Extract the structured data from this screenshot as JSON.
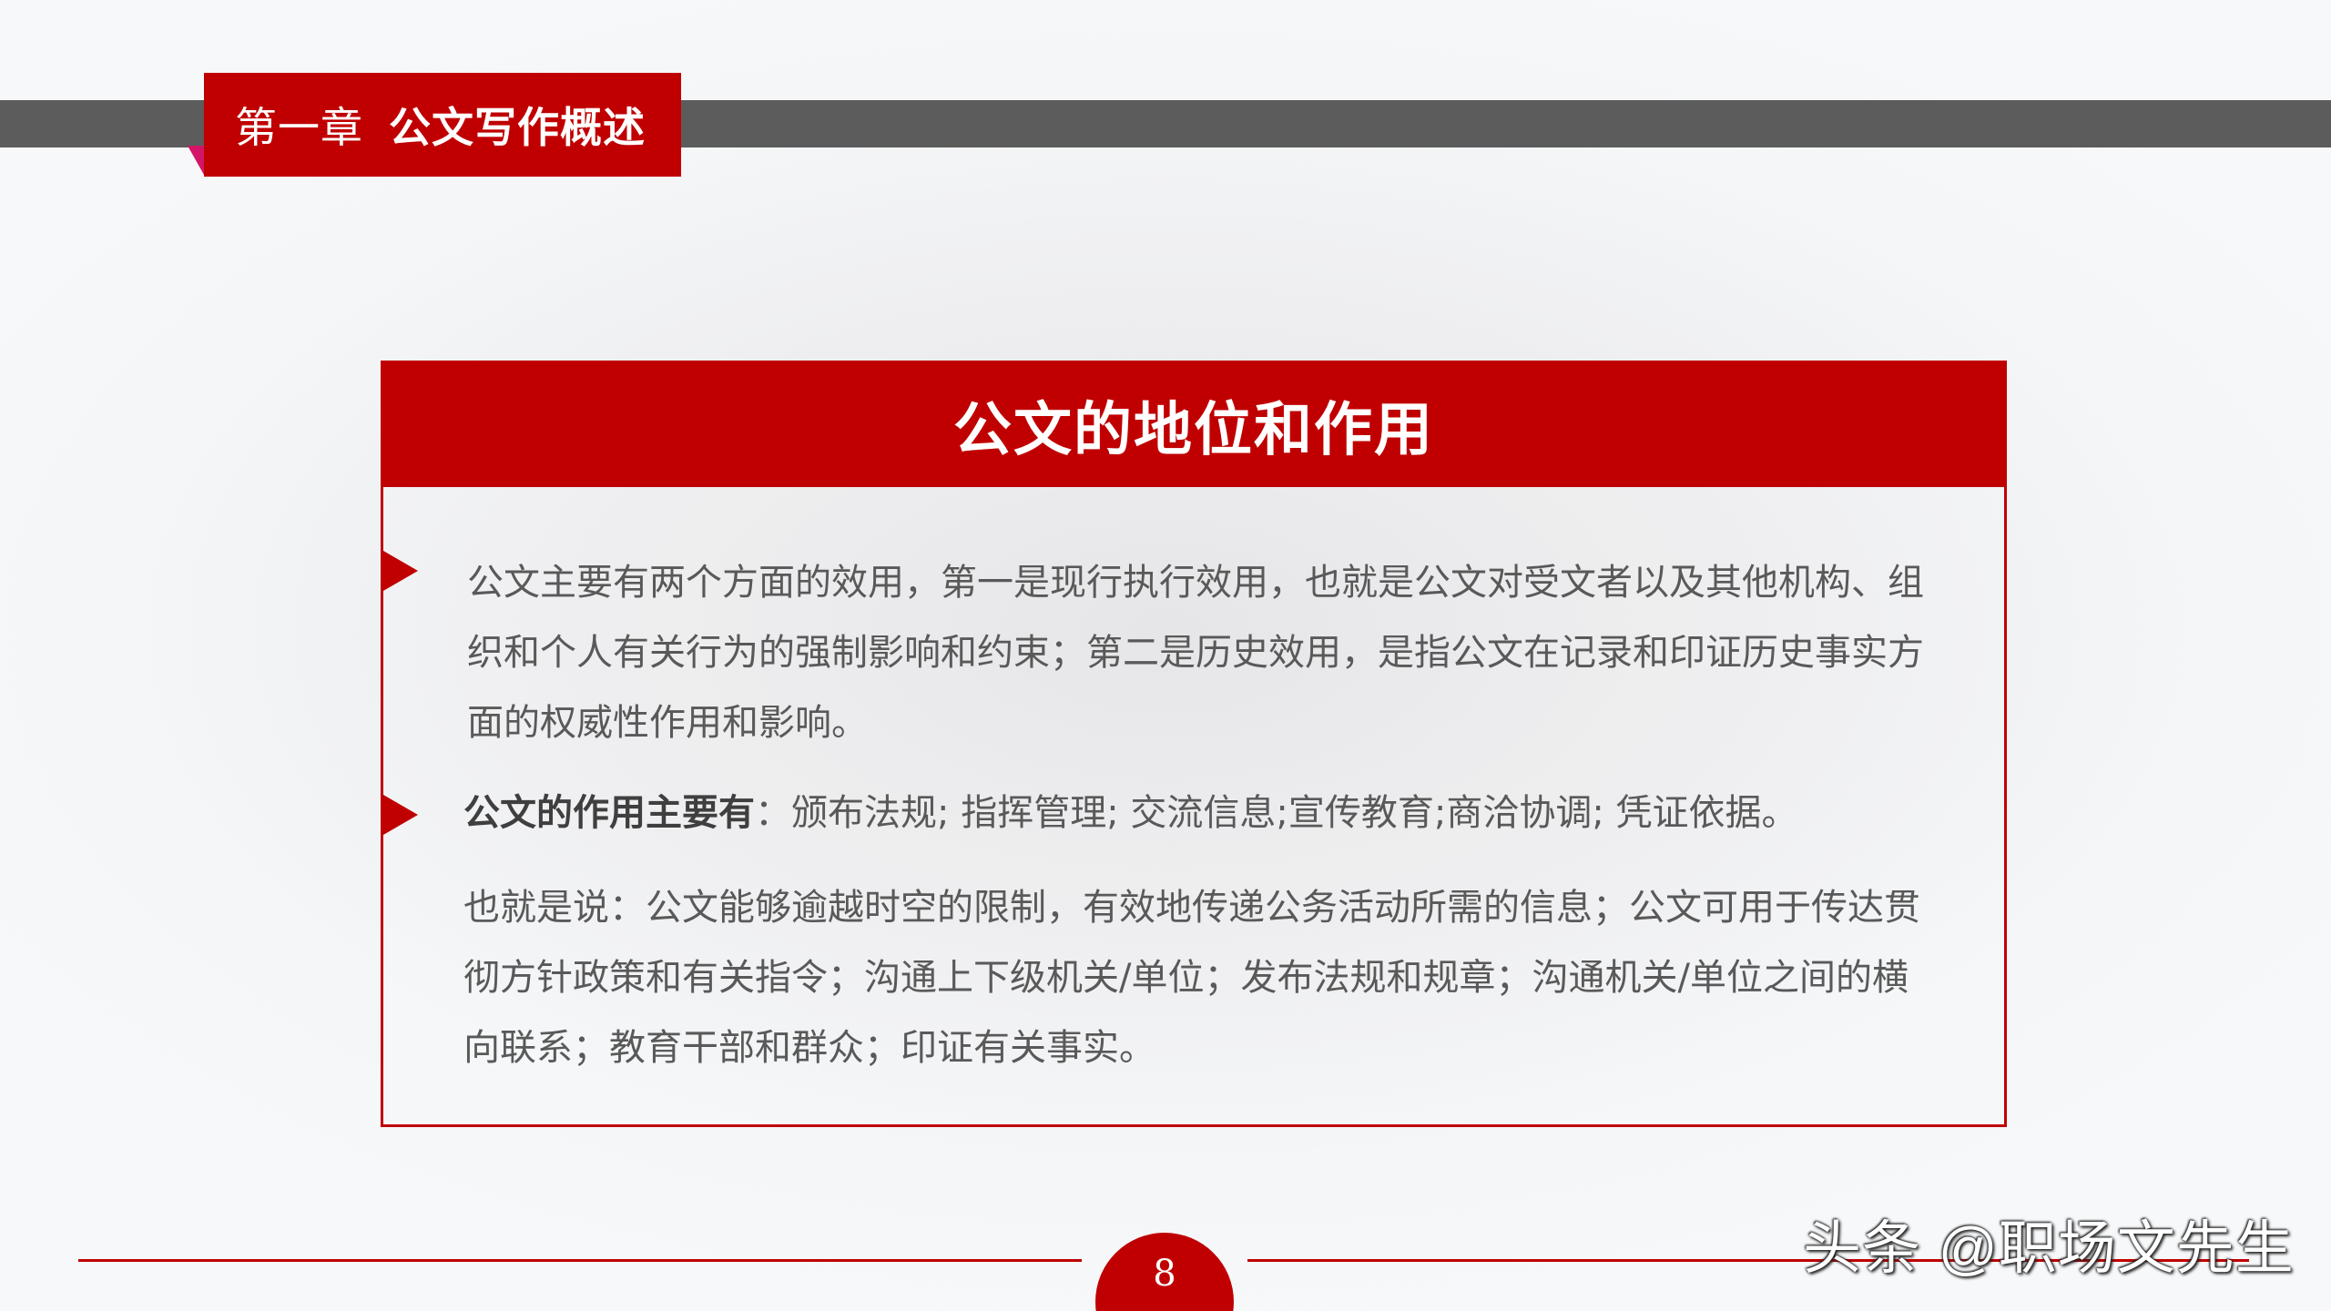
{
  "header": {
    "chapter_number": "第一章",
    "chapter_title": "公文写作概述"
  },
  "card": {
    "title": "公文的地位和作用",
    "paragraph1": "公文主要有两个方面的效用，第一是现行执行效用，也就是公文对受文者以及其他机构、组织和个人有关行为的强制影响和约束；第二是历史效用，是指公文在记录和印证历史事实方面的权威性作用和影响。",
    "paragraph2_label": "公文的作用主要有",
    "paragraph2_text": "：颁布法规; 指挥管理; 交流信息;宣传教育;商洽协调; 凭证依据。",
    "paragraph3": "也就是说：公文能够逾越时空的限制，有效地传递公务活动所需的信息；公文可用于传达贯彻方针政策和有关指令；沟通上下级机关/单位；发布法规和规章；沟通机关/单位之间的横向联系；教育干部和群众；印证有关事实。"
  },
  "footer": {
    "page_number": "8",
    "watermark": "头条 @职场文先生"
  },
  "colors": {
    "accent": "#c00000",
    "band": "#5c5c5c",
    "text": "#595959",
    "tick": "#d41567"
  }
}
